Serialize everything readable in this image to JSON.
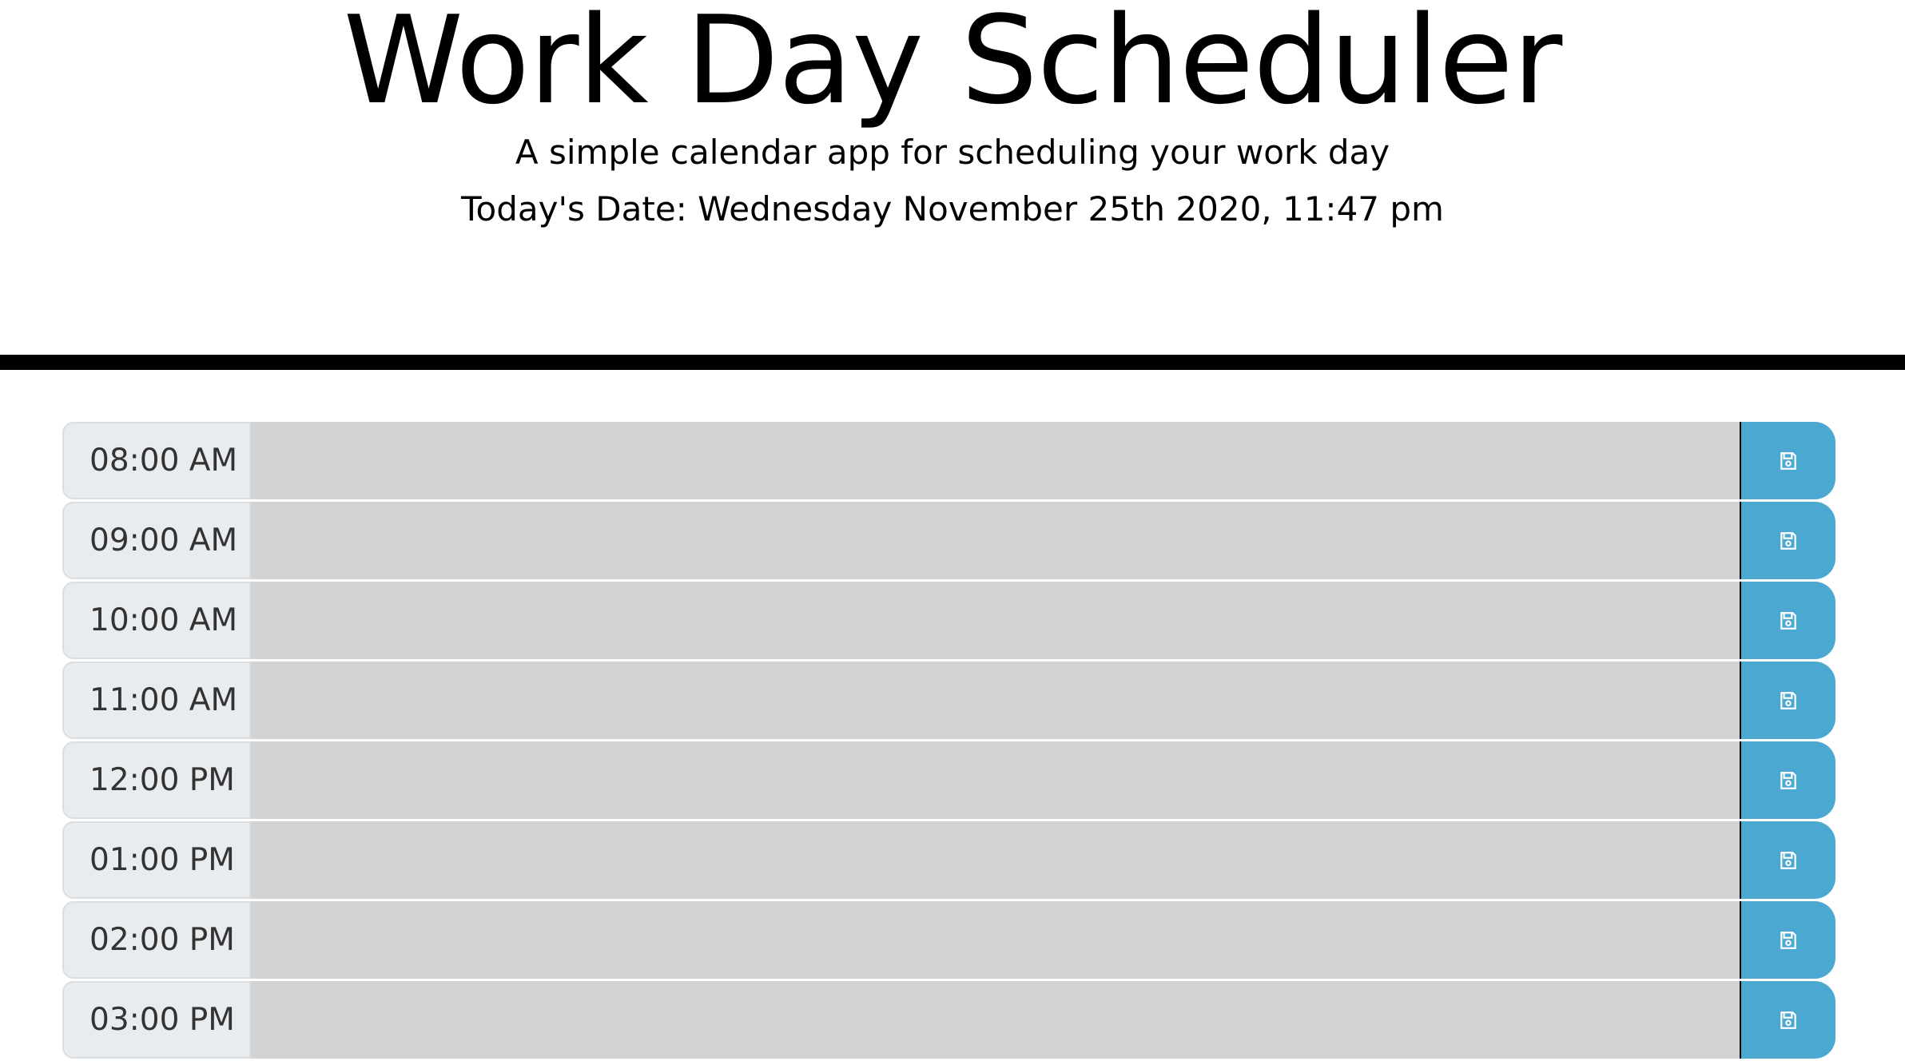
{
  "header": {
    "title": "Work Day Scheduler",
    "subtitle": "A simple calendar app for scheduling your work day",
    "date": "Today's Date: Wednesday November 25th 2020, 11:47 pm"
  },
  "rows": [
    {
      "hour": "08:00 AM",
      "text": ""
    },
    {
      "hour": "09:00 AM",
      "text": ""
    },
    {
      "hour": "10:00 AM",
      "text": ""
    },
    {
      "hour": "11:00 AM",
      "text": ""
    },
    {
      "hour": "12:00 PM",
      "text": ""
    },
    {
      "hour": "01:00 PM",
      "text": ""
    },
    {
      "hour": "02:00 PM",
      "text": ""
    },
    {
      "hour": "03:00 PM",
      "text": ""
    }
  ],
  "icons": {
    "save": "save-icon"
  },
  "colors": {
    "past_block": "#d3d3d3",
    "hour_bg": "#e9ecef",
    "save_button": "#4ba8d1",
    "divider": "#000000"
  }
}
